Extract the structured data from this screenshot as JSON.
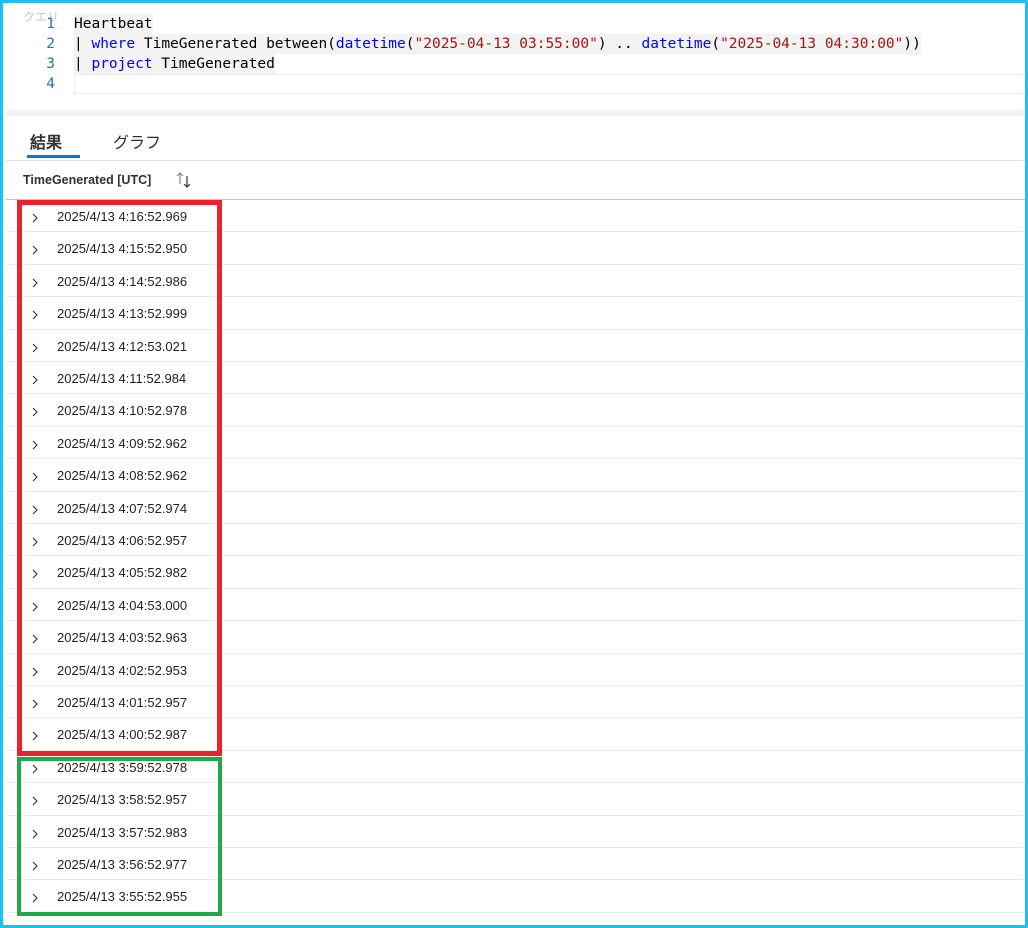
{
  "editor": {
    "label": "クエリ",
    "lines": [
      {
        "num": "1",
        "tokens": [
          {
            "t": "Heartbeat",
            "c": "op"
          }
        ]
      },
      {
        "num": "2",
        "tokens": [
          {
            "t": "| ",
            "c": "op"
          },
          {
            "t": "where",
            "c": "kw"
          },
          {
            "t": " TimeGenerated between(",
            "c": "op"
          },
          {
            "t": "datetime",
            "c": "fn"
          },
          {
            "t": "(",
            "c": "op"
          },
          {
            "t": "\"2025-04-13 03:55:00\"",
            "c": "str"
          },
          {
            "t": ") .. ",
            "c": "op"
          },
          {
            "t": "datetime",
            "c": "fn"
          },
          {
            "t": "(",
            "c": "op"
          },
          {
            "t": "\"2025-04-13 04:30:00\"",
            "c": "str"
          },
          {
            "t": "))",
            "c": "op"
          }
        ]
      },
      {
        "num": "3",
        "tokens": [
          {
            "t": "| ",
            "c": "op"
          },
          {
            "t": "project",
            "c": "kw"
          },
          {
            "t": " TimeGenerated",
            "c": "op"
          }
        ]
      },
      {
        "num": "4",
        "tokens": []
      }
    ]
  },
  "tabs": {
    "results": "結果",
    "chart": "グラフ"
  },
  "grid": {
    "column": "TimeGenerated [UTC]",
    "sort_icon": "sort-arrows-icon",
    "rows": [
      "2025/4/13 4:16:52.969",
      "2025/4/13 4:15:52.950",
      "2025/4/13 4:14:52.986",
      "2025/4/13 4:13:52.999",
      "2025/4/13 4:12:53.021",
      "2025/4/13 4:11:52.984",
      "2025/4/13 4:10:52.978",
      "2025/4/13 4:09:52.962",
      "2025/4/13 4:08:52.962",
      "2025/4/13 4:07:52.974",
      "2025/4/13 4:06:52.957",
      "2025/4/13 4:05:52.982",
      "2025/4/13 4:04:53.000",
      "2025/4/13 4:03:52.963",
      "2025/4/13 4:02:52.953",
      "2025/4/13 4:01:52.957",
      "2025/4/13 4:00:52.987",
      "2025/4/13 3:59:52.978",
      "2025/4/13 3:58:52.957",
      "2025/4/13 3:57:52.983",
      "2025/4/13 3:56:52.977",
      "2025/4/13 3:55:52.955"
    ]
  },
  "colors": {
    "frame": "#1ec0f2",
    "highlight_red": "#e8242a",
    "highlight_green": "#22a84a",
    "tab_accent": "#0078d4"
  }
}
